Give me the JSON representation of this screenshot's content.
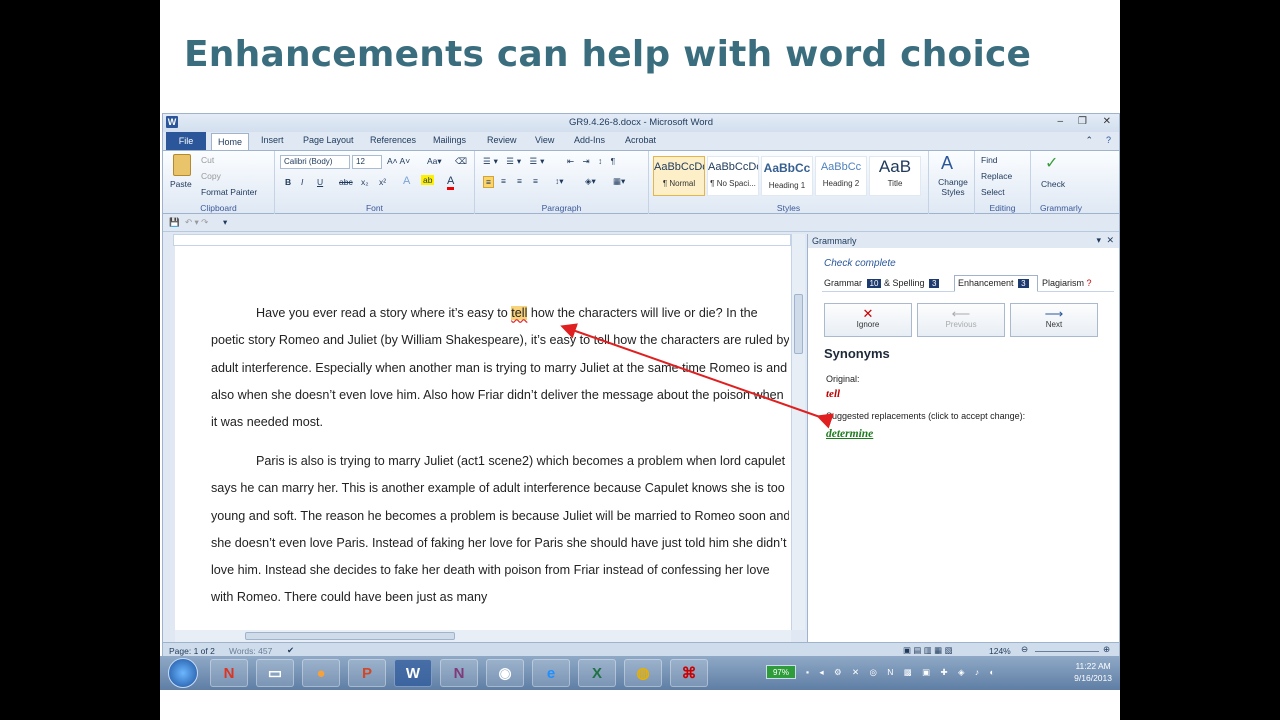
{
  "slide": {
    "title": "Enhancements can help with word choice"
  },
  "window": {
    "title": "GR9.4.26-8.docx - Microsoft Word"
  },
  "ribbon_tabs": [
    "File",
    "Home",
    "Insert",
    "Page Layout",
    "References",
    "Mailings",
    "Review",
    "View",
    "Add-Ins",
    "Acrobat"
  ],
  "clipboard": {
    "paste": "Paste",
    "cut": "Cut",
    "copy": "Copy",
    "format_painter": "Format Painter",
    "label": "Clipboard"
  },
  "font": {
    "name": "Calibri (Body)",
    "size": "12",
    "label": "Font",
    "buttons": [
      "B",
      "I",
      "U",
      "abc",
      "x₂",
      "x²"
    ]
  },
  "paragraph": {
    "label": "Paragraph"
  },
  "styles": {
    "items": [
      {
        "preview": "AaBbCcDc",
        "name": "¶ Normal"
      },
      {
        "preview": "AaBbCcDc",
        "name": "¶ No Spaci..."
      },
      {
        "preview": "AaBbCc",
        "name": "Heading 1"
      },
      {
        "preview": "AaBbCc",
        "name": "Heading 2"
      },
      {
        "preview": "AaB",
        "name": "Title"
      }
    ],
    "change_styles": "Change Styles",
    "label": "Styles"
  },
  "editing": {
    "find": "Find",
    "replace": "Replace",
    "select": "Select",
    "label": "Editing"
  },
  "grammarly_group": {
    "check": "Check",
    "label": "Grammarly"
  },
  "document": {
    "p1_before": "Have you ever read a story where it’s easy to ",
    "p1_word": "tell",
    "p1_after": " how the characters will live or die?  In the poetic story Romeo and Juliet (by William Shakespeare), it’s easy to tell how the characters are ruled by adult interference. Especially when another man is trying to marry Juliet at the same time Romeo is and also when she doesn’t even love him. Also how Friar didn’t deliver the message about the poison when it was needed most.",
    "p2": "Paris is also is trying to marry Juliet (act1 scene2) which becomes a problem when lord capulet says he can marry her. This is another example of adult interference because Capulet knows she is too young and soft. The reason he becomes a problem is because Juliet will be married to Romeo soon and she doesn’t even love Paris. Instead of faking her love for Paris she should have just told him she didn’t love him. Instead she decides to fake her death with poison from Friar instead of confessing her love with Romeo. There could have been just as many"
  },
  "grammarly": {
    "header": "Grammarly",
    "status": "Check complete",
    "tabs": [
      {
        "label": "Grammar",
        "count": "10"
      },
      {
        "label": "& Spelling",
        "count": "3"
      },
      {
        "label": "Enhancement",
        "count": "3"
      },
      {
        "label": "Plagiarism",
        "count": "?"
      }
    ],
    "buttons": {
      "ignore": "Ignore",
      "previous": "Previous",
      "next": "Next"
    },
    "heading": "Synonyms",
    "original_label": "Original:",
    "original_word": "tell",
    "suggested_label": "Suggested replacements (click to accept change):",
    "suggested_word": "determine"
  },
  "statusbar": {
    "page": "Page: 1 of 2",
    "words": "Words: 457",
    "zoom": "124%"
  },
  "taskbar": {
    "battery": "97%",
    "time": "11:22 AM",
    "date": "9/16/2013"
  },
  "colors": {
    "title": "#3a6d7e",
    "arrow": "#e02020",
    "ribbon_accent": "#2b579a"
  }
}
